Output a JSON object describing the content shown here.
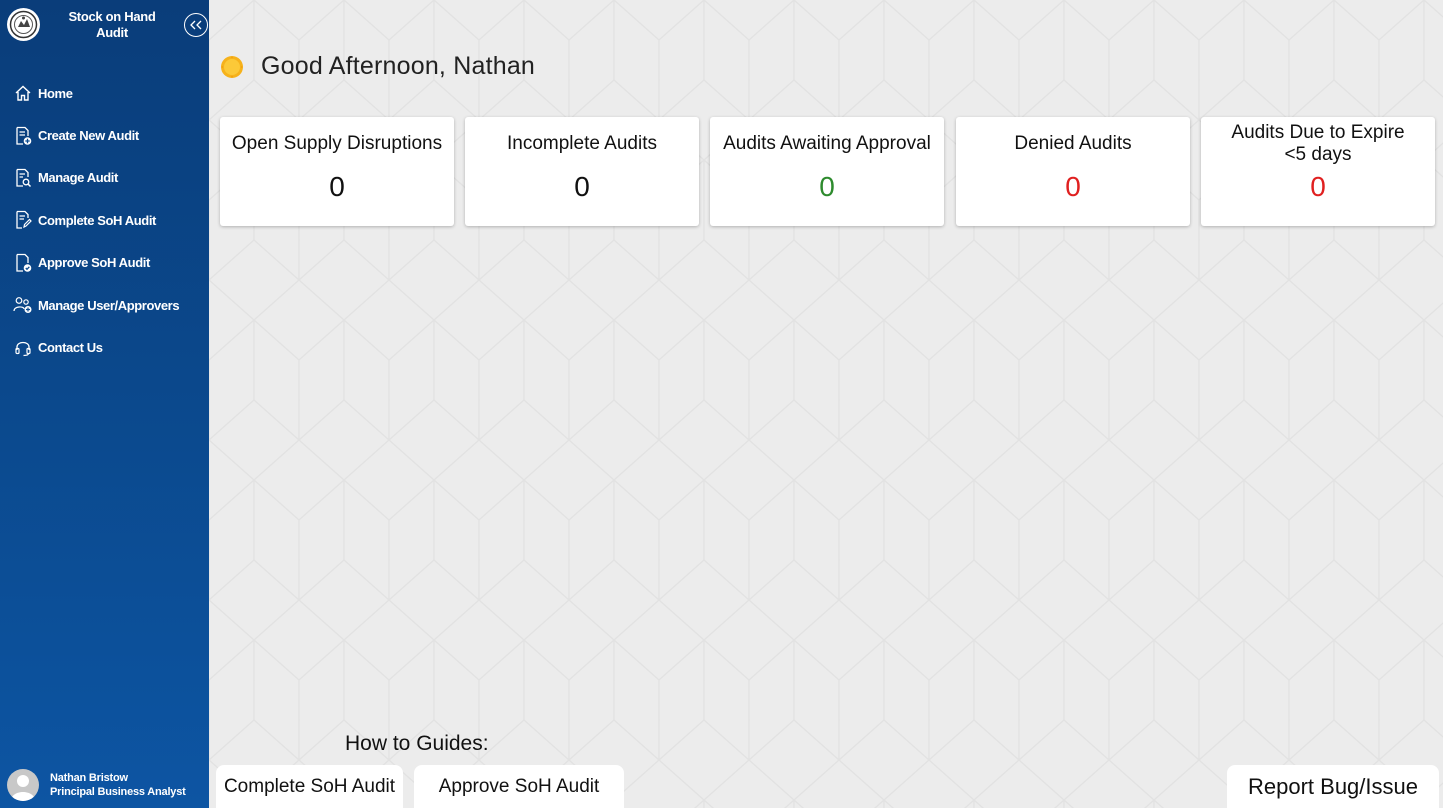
{
  "app": {
    "title": "Stock on Hand Audit"
  },
  "sidebar": {
    "items": [
      {
        "label": "Home",
        "icon": "home-icon"
      },
      {
        "label": "Create New Audit",
        "icon": "document-add-icon"
      },
      {
        "label": "Manage Audit",
        "icon": "document-search-icon"
      },
      {
        "label": "Complete SoH Audit",
        "icon": "document-edit-icon"
      },
      {
        "label": "Approve SoH Audit",
        "icon": "document-check-icon"
      },
      {
        "label": "Manage User/Approvers",
        "icon": "people-add-icon"
      },
      {
        "label": "Contact Us",
        "icon": "headset-icon"
      }
    ],
    "user": {
      "name": "Nathan Bristow",
      "role": "Principal Business Analyst"
    }
  },
  "greeting": {
    "text": "Good Afternoon, Nathan",
    "icon": "sun-icon"
  },
  "cards": [
    {
      "title": "Open Supply Disruptions",
      "value": "0",
      "color": "#111111"
    },
    {
      "title": "Incomplete Audits",
      "value": "0",
      "color": "#111111"
    },
    {
      "title": "Audits Awaiting Approval",
      "value": "0",
      "color": "#2e8b2e"
    },
    {
      "title": "Denied Audits",
      "value": "0",
      "color": "#e02020"
    },
    {
      "title": "Audits Due to Expire <5 days",
      "value": "0",
      "color": "#e02020"
    }
  ],
  "guides": {
    "label": "How to Guides:",
    "buttons": [
      "Complete SoH Audit",
      "Approve SoH Audit"
    ]
  },
  "report": {
    "label": "Report Bug/Issue"
  },
  "colors": {
    "sidebar": "#0b4a8f",
    "accent_green": "#2e8b2e",
    "accent_red": "#e02020",
    "sun": "#f6b21b"
  }
}
